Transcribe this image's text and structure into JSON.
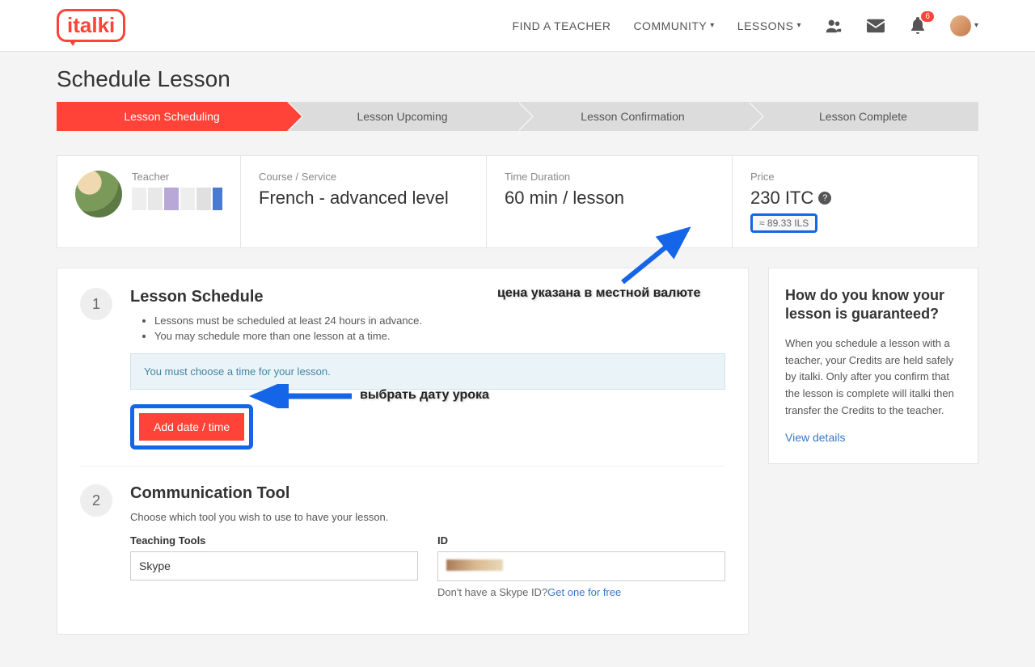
{
  "header": {
    "logo_text": "italki",
    "nav": {
      "find_teacher": "FIND A TEACHER",
      "community": "COMMUNITY",
      "lessons": "LESSONS"
    },
    "notification_count": "6"
  },
  "page_title": "Schedule Lesson",
  "steps": {
    "scheduling": "Lesson Scheduling",
    "upcoming": "Lesson Upcoming",
    "confirmation": "Lesson Confirmation",
    "complete": "Lesson Complete"
  },
  "summary": {
    "teacher_label": "Teacher",
    "course_label": "Course / Service",
    "course_value": "French - advanced level",
    "duration_label": "Time Duration",
    "duration_value": "60 min / lesson",
    "price_label": "Price",
    "price_value": "230 ITC",
    "price_local": "≈ 89.33 ILS"
  },
  "schedule": {
    "num": "1",
    "title": "Lesson Schedule",
    "bullet1": "Lessons must be scheduled at least 24 hours in advance.",
    "bullet2": "You may schedule more than one lesson at a time.",
    "notice": "You must choose a time for your lesson.",
    "add_btn": "Add date / time"
  },
  "comm": {
    "num": "2",
    "title": "Communication Tool",
    "subtext": "Choose which tool you wish to use to have your lesson.",
    "tools_label": "Teaching Tools",
    "tools_value": "Skype",
    "id_label": "ID",
    "help_prefix": "Don't have a Skype ID?",
    "help_link": "Get one for free"
  },
  "sidebar": {
    "title": "How do you know your lesson is guaranteed?",
    "text": "When you schedule a lesson with a teacher, your Credits are held safely by italki. Only after you confirm that the lesson is complete will italki then transfer the Credits to the teacher.",
    "link": "View details"
  },
  "annotations": {
    "price": "цена указана в местной валюте",
    "date": "выбрать дату урока"
  }
}
